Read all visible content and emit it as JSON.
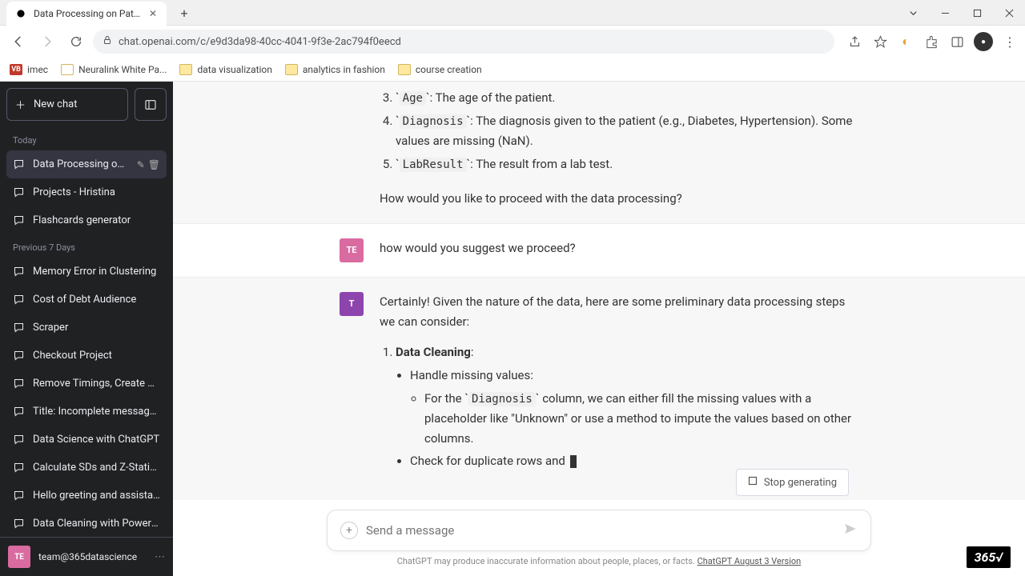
{
  "window": {
    "tab_title": "Data Processing on Patients Dat"
  },
  "address": {
    "url": "chat.openai.com/c/e9d3da98-40cc-4041-9f3e-2ac794f0eecd"
  },
  "bookmarks": [
    {
      "label": "imec",
      "kind": "vb"
    },
    {
      "label": "Neuralink White Pa...",
      "kind": "page"
    },
    {
      "label": "data visualization",
      "kind": "folder"
    },
    {
      "label": "analytics in fashion",
      "kind": "folder"
    },
    {
      "label": "course creation",
      "kind": "folder"
    }
  ],
  "sidebar": {
    "newchat": "New chat",
    "sections": [
      {
        "label": "Today",
        "items": [
          {
            "label": "Data Processing on Pa",
            "active": true
          },
          {
            "label": "Projects - Hristina"
          },
          {
            "label": "Flashcards generator"
          }
        ]
      },
      {
        "label": "Previous 7 Days",
        "items": [
          {
            "label": "Memory Error in Clustering"
          },
          {
            "label": "Cost of Debt Audience"
          },
          {
            "label": "Scraper"
          },
          {
            "label": "Checkout Project"
          },
          {
            "label": "Remove Timings, Create Scri"
          },
          {
            "label": "Title: Incomplete message, re"
          },
          {
            "label": "Data Science with ChatGPT"
          },
          {
            "label": "Calculate SDs and Z-Statistic"
          },
          {
            "label": "Hello greeting and assistance"
          },
          {
            "label": "Data Cleaning with Power Qu"
          }
        ]
      }
    ],
    "user": {
      "initials": "TE",
      "email": "team@365datascience"
    }
  },
  "conversation": {
    "msg0": {
      "li3_code": "Age",
      "li3_text": ": The age of the patient.",
      "li4_code": "Diagnosis",
      "li4_text_a": ": The diagnosis given to the patient (e.g., Diabetes, Hypertension). Some values are missing (NaN).",
      "li5_code": "LabResult",
      "li5_text": ": The result from a lab test.",
      "followup": "How would you like to proceed with the data processing?"
    },
    "msg1": {
      "avatar": "TE",
      "text": "how would you suggest we proceed?"
    },
    "msg2": {
      "avatar": "T",
      "intro": "Certainly! Given the nature of the data, here are some preliminary data processing steps we can consider:",
      "step1_title": "Data Cleaning",
      "step1_colon": ":",
      "b1": "Handle missing values:",
      "b1a_pre": "For the ",
      "b1a_code": "Diagnosis",
      "b1a_post": " column, we can either fill the missing values with a placeholder like \"Unknown\" or use a method to impute the values based on other columns.",
      "b2": "Check for duplicate rows and "
    }
  },
  "controls": {
    "stop": "Stop generating",
    "placeholder": "Send a message",
    "disclaimer_a": "ChatGPT may produce inaccurate information about people, places, or facts. ",
    "disclaimer_link": "ChatGPT August 3 Version"
  },
  "watermark": "365√"
}
